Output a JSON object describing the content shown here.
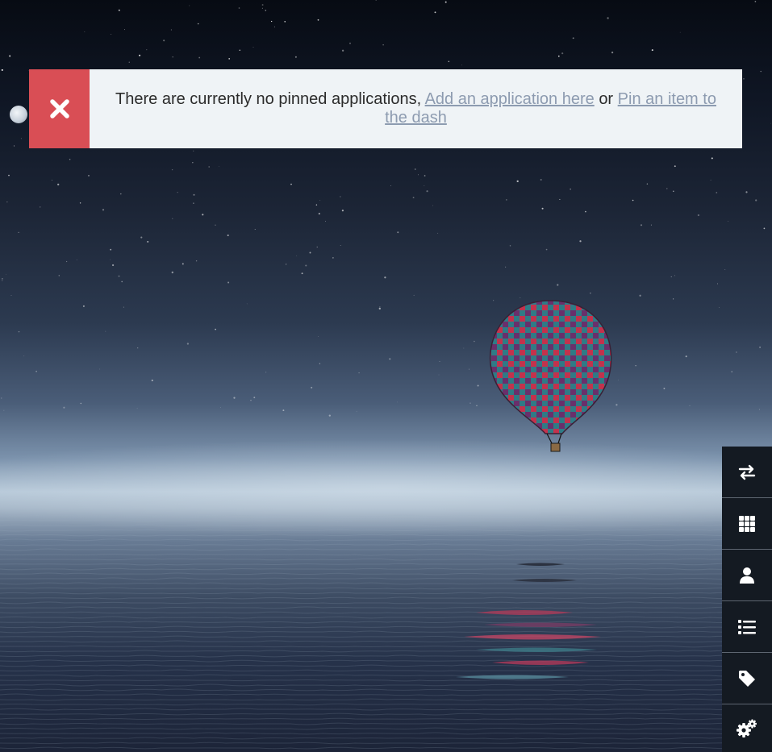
{
  "notice": {
    "message": "There are currently no pinned applications,",
    "link_add": "Add an application here",
    "connector": "or",
    "link_pin": "Pin an item to the dash",
    "close_icon": "close-icon",
    "close_color": "#d94e55",
    "background_color": "#eff3f6",
    "link_color": "#8d9bb0"
  },
  "side_menu": {
    "items": [
      {
        "name": "switch-view",
        "icon": "swap-arrows-icon"
      },
      {
        "name": "applications",
        "icon": "grid-icon"
      },
      {
        "name": "users",
        "icon": "user-icon"
      },
      {
        "name": "items-list",
        "icon": "list-icon"
      },
      {
        "name": "tags",
        "icon": "tag-icon"
      },
      {
        "name": "settings",
        "icon": "gears-icon"
      }
    ],
    "button_color": "#141a22"
  }
}
